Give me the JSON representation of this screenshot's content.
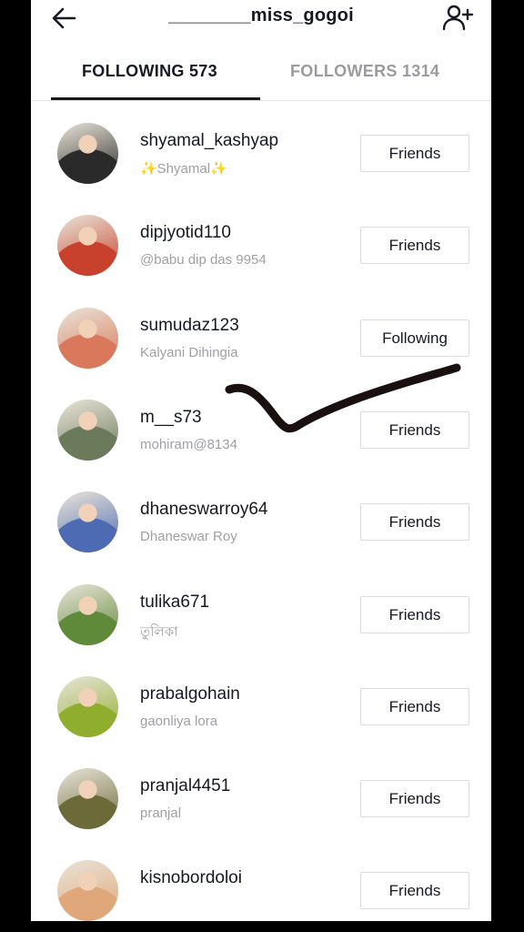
{
  "header": {
    "title": "________miss_gogoi",
    "back_icon": "arrow-left-icon",
    "add_icon": "add-user-icon"
  },
  "tabs": [
    {
      "label": "FOLLOWING 573",
      "active": true
    },
    {
      "label": "FOLLOWERS 1314",
      "active": false
    }
  ],
  "users": [
    {
      "username": "shyamal_kashyap",
      "nickname": "✨Shyamal✨",
      "button": "Friends",
      "avatar_color": "#2a2a2a"
    },
    {
      "username": "dipjyotid110",
      "nickname": "@babu dip das 9954",
      "button": "Friends",
      "avatar_color": "#c8412c"
    },
    {
      "username": "sumudaz123",
      "nickname": "Kalyani Dihingia",
      "button": "Following",
      "avatar_color": "#d9785a"
    },
    {
      "username": "m__s73",
      "nickname": "mohiram@8134",
      "button": "Friends",
      "avatar_color": "#6b7a5a"
    },
    {
      "username": "dhaneswarroy64",
      "nickname": "Dhaneswar Roy",
      "button": "Friends",
      "avatar_color": "#4d6bb3"
    },
    {
      "username": "tulika671",
      "nickname": "তুলিকা",
      "button": "Friends",
      "avatar_color": "#5e8a3a"
    },
    {
      "username": "prabalgohain",
      "nickname": "gaonliya lora",
      "button": "Friends",
      "avatar_color": "#8fae2e"
    },
    {
      "username": "pranjal4451",
      "nickname": "pranjal",
      "button": "Friends",
      "avatar_color": "#6d6a3a"
    },
    {
      "username": "kisnobordoloi",
      "nickname": "",
      "button": "Friends",
      "avatar_color": "#e0a77a"
    }
  ],
  "annotation": {
    "icon": "checkmark-annotation",
    "color": "#1a1010"
  }
}
